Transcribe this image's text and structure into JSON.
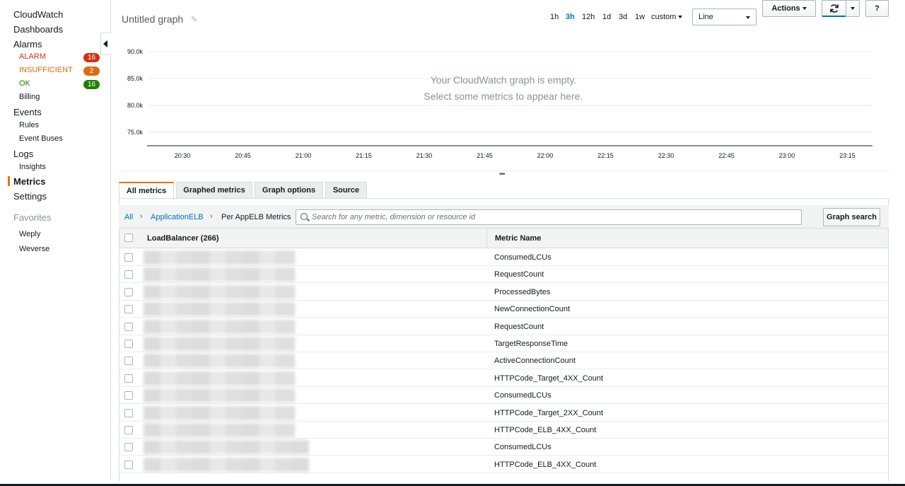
{
  "sidebar": {
    "items": [
      {
        "label": "CloudWatch",
        "level": 1
      },
      {
        "label": "Dashboards",
        "level": 1
      },
      {
        "label": "Alarms",
        "level": 1
      },
      {
        "label": "ALARM",
        "level": 2,
        "color": "#d13212",
        "badge": "16",
        "badge_color": "#d13212"
      },
      {
        "label": "INSUFFICIENT",
        "level": 2,
        "color": "#dd6b10",
        "badge": "2",
        "badge_color": "#dd6b10"
      },
      {
        "label": "OK",
        "level": 2,
        "color": "#1d8102",
        "badge": "16",
        "badge_color": "#1d8102"
      },
      {
        "label": "Billing",
        "level": 2
      },
      {
        "label": "Events",
        "level": 1
      },
      {
        "label": "Rules",
        "level": 2
      },
      {
        "label": "Event Buses",
        "level": 2
      },
      {
        "label": "Logs",
        "level": 1
      },
      {
        "label": "Insights",
        "level": 2
      },
      {
        "label": "Metrics",
        "level": 1,
        "active": true
      },
      {
        "label": "Settings",
        "level": 1
      }
    ],
    "favorites_heading": "Favorites",
    "favorites": [
      "Weply",
      "Weverse"
    ]
  },
  "header": {
    "title": "Untitled graph",
    "time_ranges": [
      "1h",
      "3h",
      "12h",
      "1d",
      "3d",
      "1w"
    ],
    "selected_range": "3h",
    "custom_label": "custom",
    "chart_type_select": "Line",
    "actions_label": "Actions",
    "help_label": "?"
  },
  "chart_data": {
    "type": "line",
    "y_ticks": [
      "90.0k",
      "85.0k",
      "80.0k",
      "75.0k"
    ],
    "x_ticks": [
      "20:30",
      "20:45",
      "21:00",
      "21:15",
      "21:30",
      "21:45",
      "22:00",
      "22:15",
      "22:30",
      "22:45",
      "23:00",
      "23:15"
    ],
    "series": [],
    "grid": true,
    "empty_message_line1": "Your CloudWatch graph is empty.",
    "empty_message_line2": "Select some metrics to appear here."
  },
  "tabs": [
    {
      "label": "All metrics",
      "active": true
    },
    {
      "label": "Graphed metrics"
    },
    {
      "label": "Graph options"
    },
    {
      "label": "Source"
    }
  ],
  "breadcrumb": [
    "All",
    "ApplicationELB",
    "Per AppELB Metrics"
  ],
  "search": {
    "placeholder": "Search for any metric, dimension or resource id"
  },
  "graph_search_label": "Graph search",
  "table": {
    "columns": [
      "LoadBalancer  (266)",
      "Metric Name"
    ],
    "rows": [
      "ConsumedLCUs",
      "RequestCount",
      "ProcessedBytes",
      "NewConnectionCount",
      "RequestCount",
      "TargetResponseTime",
      "ActiveConnectionCount",
      "HTTPCode_Target_4XX_Count",
      "ConsumedLCUs",
      "HTTPCode_Target_2XX_Count",
      "HTTPCode_ELB_4XX_Count",
      "ConsumedLCUs",
      "HTTPCode_ELB_4XX_Count"
    ]
  },
  "colors": {
    "accent": "#ec7211",
    "link": "#0073bb"
  }
}
